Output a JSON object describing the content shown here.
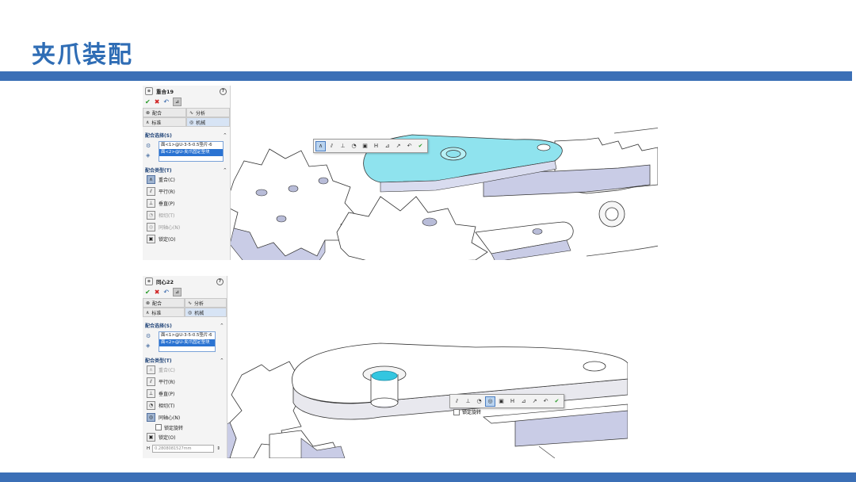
{
  "page": {
    "title": "夹爪装配"
  },
  "colors": {
    "accent": "#3b6fb6",
    "title": "#2f6db5",
    "highlight_face": "#8fe3ee",
    "gear_shadow": "#c9cce6"
  },
  "panel1": {
    "feature_name": "重合19",
    "tabs": {
      "mates": "配合",
      "analysis": "分析",
      "standard": "标准",
      "mechanical": "机械"
    },
    "tab_icons": [
      "mate-icon",
      "analysis-icon",
      "standard-icon",
      "mechanical-icon"
    ],
    "selections_header": "配合选择(S)",
    "selections": [
      "面<1>@U-3-5-0.5垫片-6",
      "面<2>@U-夹爪固定垫块"
    ],
    "mate_types_header": "配合类型(T)",
    "mate_types": [
      "重合(C)",
      "平行(R)",
      "垂直(P)",
      "相切(T)",
      "同轴心(N)",
      "锁定(O)"
    ],
    "selected_mate": "重合(C)"
  },
  "panel2": {
    "feature_name": "同心22",
    "tabs": {
      "mates": "配合",
      "analysis": "分析",
      "standard": "标准",
      "mechanical": "机械"
    },
    "selections_header": "配合选择(S)",
    "selections": [
      "面<1>@U-3-5-0.5垫片-6",
      "面<2>@U-夹爪固定垫块"
    ],
    "mate_types_header": "配合类型(T)",
    "mate_types": [
      "重合(C)",
      "平行(R)",
      "垂直(P)",
      "相切(T)",
      "同轴心(N)"
    ],
    "selected_mate": "同轴心(N)",
    "lock_rotation": "锁定旋转",
    "lock": "锁定(O)",
    "distance_value": "0.2808081527mm",
    "toolbar_lock_rotation": "锁定旋转"
  }
}
